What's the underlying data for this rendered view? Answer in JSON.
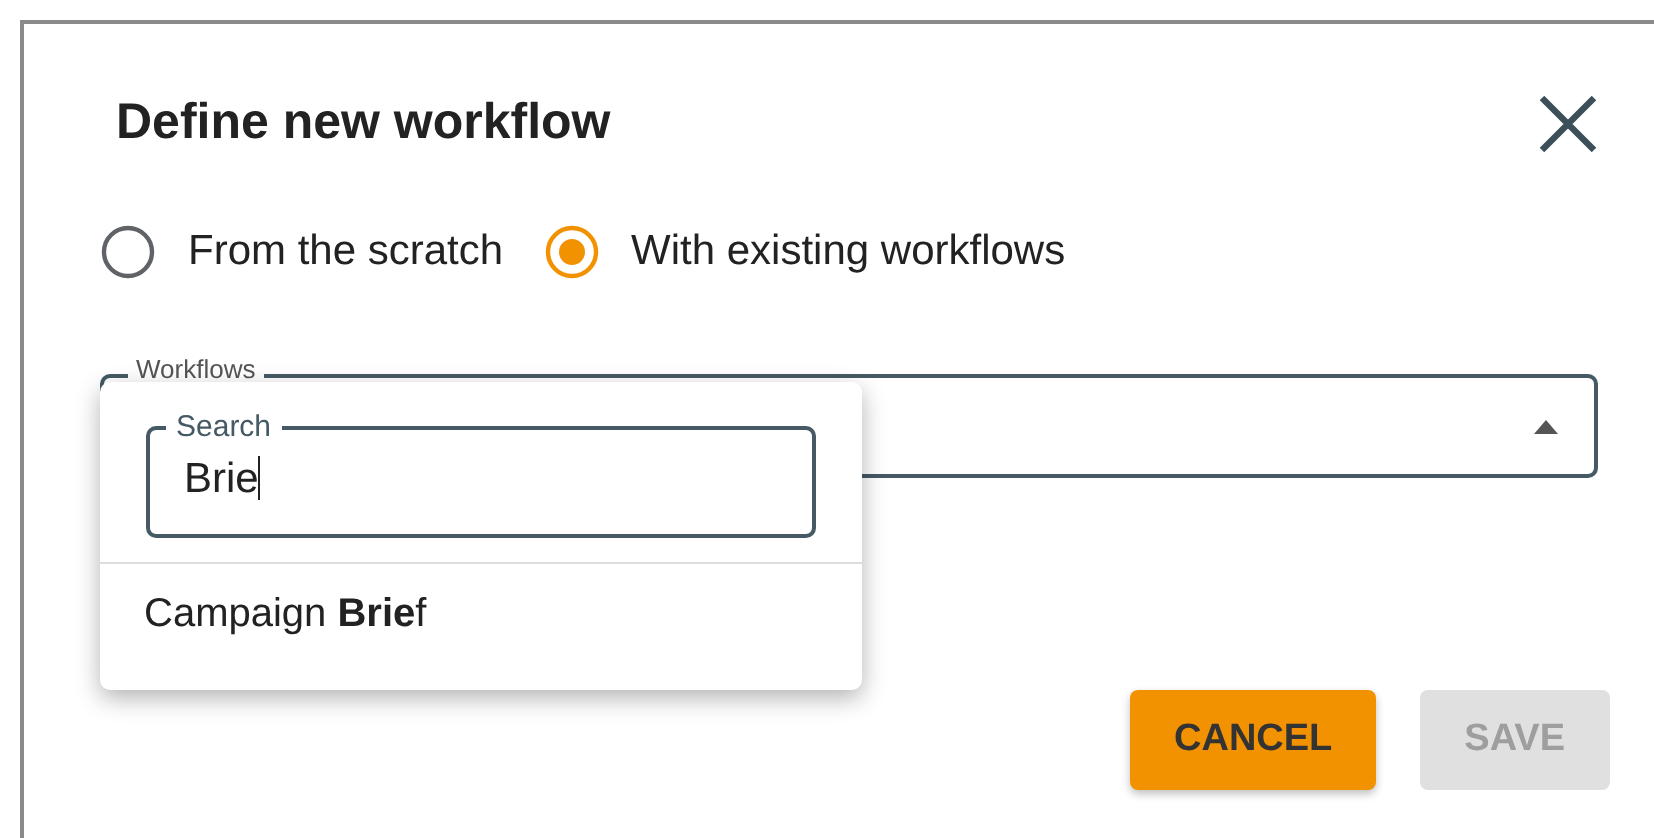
{
  "dialog": {
    "title": "Define new workflow"
  },
  "modes": [
    {
      "label": "From the scratch",
      "selected": false
    },
    {
      "label": "With existing workflows",
      "selected": true
    }
  ],
  "workflows_select": {
    "label": "Workflows",
    "expanded": true
  },
  "dropdown": {
    "search": {
      "label": "Search",
      "value": "Brie"
    },
    "options": [
      {
        "label": "Campaign **Brie**f"
      }
    ]
  },
  "buttons": [
    {
      "label": "CANCEL",
      "disabled": false
    },
    {
      "label": "SAVE",
      "disabled": true
    }
  ]
}
